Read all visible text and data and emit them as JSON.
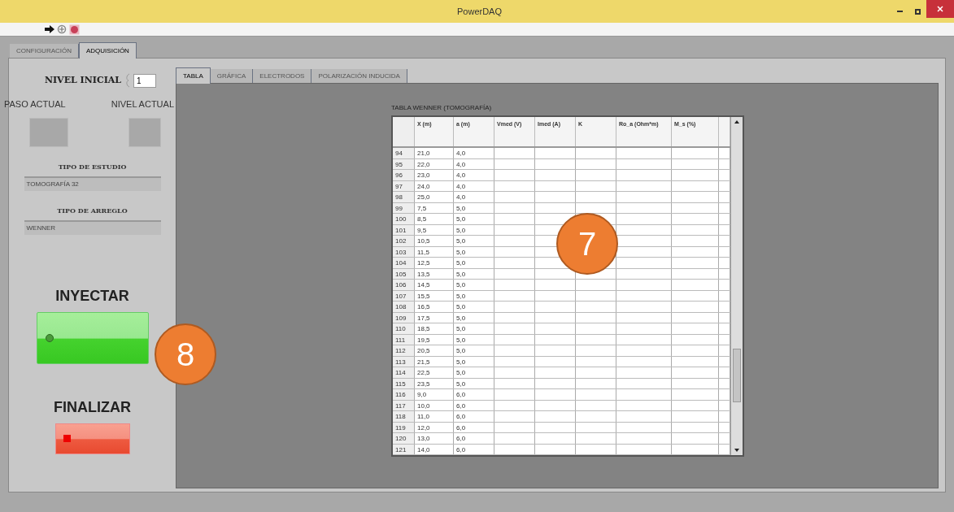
{
  "window": {
    "title": "PowerDAQ"
  },
  "outer_tabs": [
    {
      "label": "CONFIGURACIÓN",
      "selected": false
    },
    {
      "label": "ADQUISICIÓN",
      "selected": true
    }
  ],
  "controls": {
    "nivel_inicial": {
      "label": "NIVEL INICIAL",
      "value": "1"
    },
    "paso_actual": {
      "label": "PASO ACTUAL"
    },
    "nivel_actual": {
      "label": "NIVEL ACTUAL"
    },
    "tipo_estudio": {
      "label": "TIPO DE ESTUDIO",
      "value": "TOMOGRAFÍA 32"
    },
    "tipo_arreglo": {
      "label": "TIPO DE ARREGLO",
      "value": "WENNER"
    },
    "inyectar": {
      "label": "INYECTAR"
    },
    "finalizar": {
      "label": "FINALIZAR"
    }
  },
  "inner_tabs": [
    {
      "label": "TABLA",
      "selected": true
    },
    {
      "label": "GRÁFICA",
      "selected": false
    },
    {
      "label": "ELECTRODOS",
      "selected": false
    },
    {
      "label": "POLARIZACIÓN INDUCIDA",
      "selected": false
    }
  ],
  "table": {
    "title": "TABLA WENNER (TOMOGRAFÍA)",
    "columns": [
      "",
      "X (m)",
      "a (m)",
      "Vmed (V)",
      "Imed (A)",
      "K",
      "Ro_a (Ohm*m)",
      "M_s (%)"
    ],
    "rows": [
      [
        "94",
        "21,0",
        "4,0"
      ],
      [
        "95",
        "22,0",
        "4,0"
      ],
      [
        "96",
        "23,0",
        "4,0"
      ],
      [
        "97",
        "24,0",
        "4,0"
      ],
      [
        "98",
        "25,0",
        "4,0"
      ],
      [
        "99",
        "7,5",
        "5,0"
      ],
      [
        "100",
        "8,5",
        "5,0"
      ],
      [
        "101",
        "9,5",
        "5,0"
      ],
      [
        "102",
        "10,5",
        "5,0"
      ],
      [
        "103",
        "11,5",
        "5,0"
      ],
      [
        "104",
        "12,5",
        "5,0"
      ],
      [
        "105",
        "13,5",
        "5,0"
      ],
      [
        "106",
        "14,5",
        "5,0"
      ],
      [
        "107",
        "15,5",
        "5,0"
      ],
      [
        "108",
        "16,5",
        "5,0"
      ],
      [
        "109",
        "17,5",
        "5,0"
      ],
      [
        "110",
        "18,5",
        "5,0"
      ],
      [
        "111",
        "19,5",
        "5,0"
      ],
      [
        "112",
        "20,5",
        "5,0"
      ],
      [
        "113",
        "21,5",
        "5,0"
      ],
      [
        "114",
        "22,5",
        "5,0"
      ],
      [
        "115",
        "23,5",
        "5,0"
      ],
      [
        "116",
        "9,0",
        "6,0"
      ],
      [
        "117",
        "10,0",
        "6,0"
      ],
      [
        "118",
        "11,0",
        "6,0"
      ],
      [
        "119",
        "12,0",
        "6,0"
      ],
      [
        "120",
        "13,0",
        "6,0"
      ],
      [
        "121",
        "14,0",
        "6,0"
      ]
    ]
  },
  "callouts": [
    "7",
    "8"
  ]
}
